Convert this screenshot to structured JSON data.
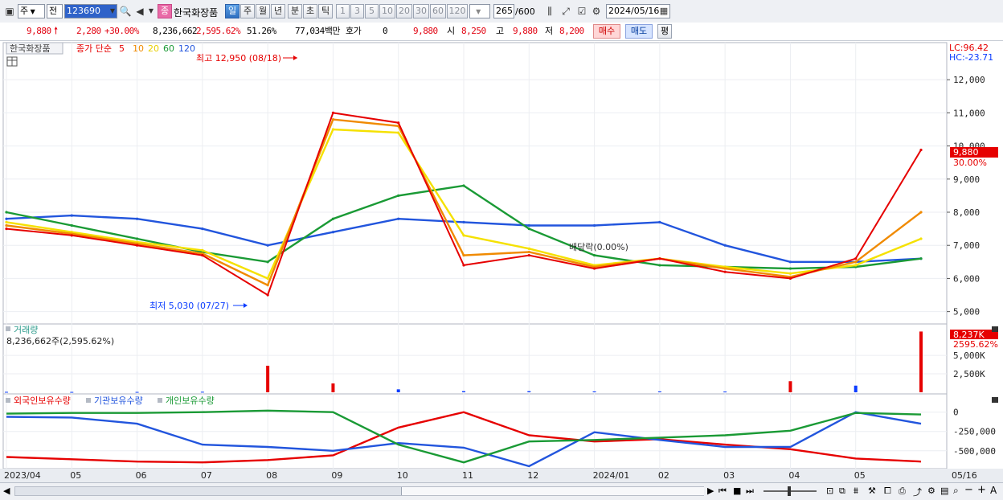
{
  "toolbar": {
    "type_label": "주",
    "prev_label": "전",
    "code_value": "123690",
    "stock_badge": "종",
    "stock_name": "한국화장품",
    "periods": [
      "일",
      "주",
      "월",
      "년",
      "분",
      "초",
      "틱"
    ],
    "active_period": "일",
    "intervals": [
      "1",
      "3",
      "5",
      "10",
      "20",
      "30",
      "60",
      "120"
    ],
    "count_value": "265",
    "count_max": "/600",
    "date_value": "2024/05/16"
  },
  "quote": {
    "price": "9,880",
    "change": "2,280",
    "change_pct": "+30.00%",
    "volume": "8,236,662",
    "volume_pct": "2,595.62%",
    "turnover_pct": "51.26%",
    "amount": "77,034백만",
    "hoga_label": "호가",
    "hoga_value": "0",
    "bid_value": "9,880",
    "open_label": "시",
    "open_value": "8,250",
    "high_label": "고",
    "high_value": "9,880",
    "low_label": "저",
    "low_value": "8,200",
    "buy_button": "매수",
    "sell_button": "매도",
    "settle_button": "평"
  },
  "price_panel": {
    "name_label": "한국화장품",
    "ma_title": "종가 단순",
    "ma_periods": [
      "5",
      "10",
      "20",
      "60",
      "120"
    ],
    "ma_colors": [
      "#e60000",
      "#f08a00",
      "#f5e100",
      "#1a9a35",
      "#2255dd"
    ],
    "high_annotation": "최고 12,950 (08/18)",
    "low_annotation": "최저 5,030 (07/27)",
    "dividend_label": "배당락(0.00%)",
    "lc_label": "LC:96.42",
    "hc_label": "HC:-23.71",
    "last_price_tag": "9,880",
    "last_pct_tag": "30.00%",
    "y_ticks": [
      "12,000",
      "11,000",
      "10,000",
      "9,000",
      "8,000",
      "7,000",
      "6,000",
      "5,000"
    ]
  },
  "volume_panel": {
    "title": "거래량",
    "info": "8,236,662주(2,595.62%)",
    "tag_value": "8,237K",
    "tag_pct": "2595.62%",
    "y_ticks": [
      "5,000K",
      "2,500K"
    ]
  },
  "holdings_panel": {
    "legends": [
      {
        "label": "외국인보유수량",
        "color": "#e60000"
      },
      {
        "label": "기관보유수량",
        "color": "#2255dd"
      },
      {
        "label": "개인보유수량",
        "color": "#1a9a35"
      }
    ],
    "y_ticks": [
      "0",
      "-250,000",
      "-500,000"
    ]
  },
  "x_axis": {
    "labels": [
      "2023/04",
      "05",
      "06",
      "07",
      "08",
      "09",
      "10",
      "11",
      "12",
      "2024/01",
      "02",
      "03",
      "04",
      "05",
      "05/16"
    ]
  },
  "colors": {
    "up": "#e60000",
    "down": "#0a3cff",
    "accent_red": "#e1000f"
  },
  "chart_data": [
    {
      "type": "line",
      "title": "한국화장품",
      "x": [
        "2023/04",
        "05",
        "06",
        "07",
        "08",
        "09",
        "10",
        "11",
        "12",
        "2024/01",
        "02",
        "03",
        "04",
        "05",
        "05/16"
      ],
      "ylim": [
        4700,
        12950
      ],
      "series": [
        {
          "name": "5",
          "values": [
            7500,
            7300,
            7000,
            6700,
            5500,
            11000,
            10700,
            6400,
            6700,
            6300,
            6600,
            6200,
            6000,
            6600,
            9880
          ]
        },
        {
          "name": "10",
          "values": [
            7600,
            7350,
            7050,
            6750,
            5800,
            10800,
            10600,
            6700,
            6800,
            6350,
            6600,
            6300,
            6050,
            6500,
            8000
          ]
        },
        {
          "name": "20",
          "values": [
            7700,
            7400,
            7100,
            6850,
            6000,
            10500,
            10400,
            7300,
            6900,
            6400,
            6600,
            6350,
            6150,
            6400,
            7200
          ]
        },
        {
          "name": "60",
          "values": [
            8000,
            7600,
            7200,
            6800,
            6500,
            7800,
            8500,
            8800,
            7500,
            6700,
            6400,
            6350,
            6300,
            6350,
            6600
          ]
        },
        {
          "name": "120",
          "values": [
            7800,
            7900,
            7800,
            7500,
            7000,
            7400,
            7800,
            7700,
            7600,
            7600,
            7700,
            7000,
            6500,
            6500,
            6600
          ]
        }
      ],
      "annotations": [
        "최고 12,950 (08/18)",
        "최저 5,030 (07/27)",
        "배당락(0.00%)"
      ]
    },
    {
      "type": "bar",
      "title": "거래량",
      "categories": [
        "2023/04",
        "05",
        "06",
        "07",
        "08",
        "09",
        "10",
        "11",
        "12",
        "2024/01",
        "02",
        "03",
        "04",
        "05",
        "05/16"
      ],
      "values": [
        60,
        50,
        50,
        70,
        3600,
        1200,
        400,
        150,
        150,
        120,
        120,
        100,
        1500,
        900,
        8237
      ],
      "ylim": [
        0,
        8500
      ]
    },
    {
      "type": "line",
      "x": [
        "2023/04",
        "05",
        "06",
        "07",
        "08",
        "09",
        "10",
        "11",
        "12",
        "2024/01",
        "02",
        "03",
        "04",
        "05",
        "05/16"
      ],
      "ylim": [
        -700000,
        80000
      ],
      "series": [
        {
          "name": "외국인보유수량",
          "values": [
            -580000,
            -610000,
            -640000,
            -650000,
            -620000,
            -560000,
            -200000,
            0,
            -300000,
            -380000,
            -350000,
            -420000,
            -480000,
            -600000,
            -640000
          ]
        },
        {
          "name": "기관보유수량",
          "values": [
            -60000,
            -70000,
            -150000,
            -420000,
            -450000,
            -500000,
            -400000,
            -460000,
            -700000,
            -260000,
            -360000,
            -450000,
            -450000,
            0,
            -150000
          ]
        },
        {
          "name": "개인보유수량",
          "values": [
            -20000,
            -10000,
            -10000,
            0,
            20000,
            0,
            -420000,
            -650000,
            -380000,
            -360000,
            -330000,
            -300000,
            -240000,
            -10000,
            -30000
          ]
        }
      ]
    }
  ]
}
